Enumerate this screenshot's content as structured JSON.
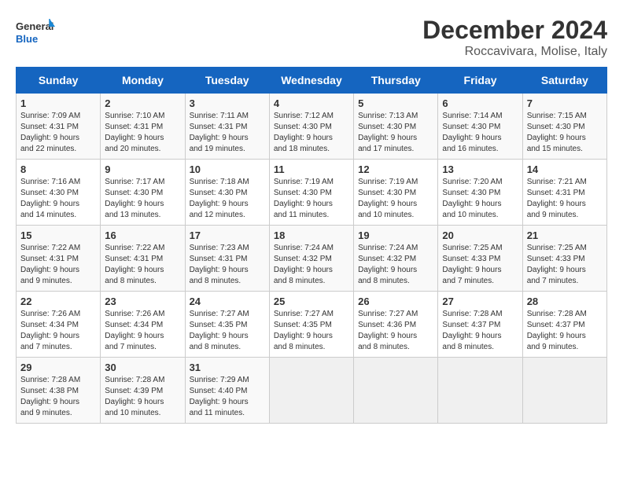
{
  "logo": {
    "line1": "General",
    "line2": "Blue"
  },
  "title": "December 2024",
  "subtitle": "Roccavivara, Molise, Italy",
  "days_of_week": [
    "Sunday",
    "Monday",
    "Tuesday",
    "Wednesday",
    "Thursday",
    "Friday",
    "Saturday"
  ],
  "weeks": [
    [
      {
        "day": "1",
        "info": "Sunrise: 7:09 AM\nSunset: 4:31 PM\nDaylight: 9 hours\nand 22 minutes."
      },
      {
        "day": "2",
        "info": "Sunrise: 7:10 AM\nSunset: 4:31 PM\nDaylight: 9 hours\nand 20 minutes."
      },
      {
        "day": "3",
        "info": "Sunrise: 7:11 AM\nSunset: 4:31 PM\nDaylight: 9 hours\nand 19 minutes."
      },
      {
        "day": "4",
        "info": "Sunrise: 7:12 AM\nSunset: 4:30 PM\nDaylight: 9 hours\nand 18 minutes."
      },
      {
        "day": "5",
        "info": "Sunrise: 7:13 AM\nSunset: 4:30 PM\nDaylight: 9 hours\nand 17 minutes."
      },
      {
        "day": "6",
        "info": "Sunrise: 7:14 AM\nSunset: 4:30 PM\nDaylight: 9 hours\nand 16 minutes."
      },
      {
        "day": "7",
        "info": "Sunrise: 7:15 AM\nSunset: 4:30 PM\nDaylight: 9 hours\nand 15 minutes."
      }
    ],
    [
      {
        "day": "8",
        "info": "Sunrise: 7:16 AM\nSunset: 4:30 PM\nDaylight: 9 hours\nand 14 minutes."
      },
      {
        "day": "9",
        "info": "Sunrise: 7:17 AM\nSunset: 4:30 PM\nDaylight: 9 hours\nand 13 minutes."
      },
      {
        "day": "10",
        "info": "Sunrise: 7:18 AM\nSunset: 4:30 PM\nDaylight: 9 hours\nand 12 minutes."
      },
      {
        "day": "11",
        "info": "Sunrise: 7:19 AM\nSunset: 4:30 PM\nDaylight: 9 hours\nand 11 minutes."
      },
      {
        "day": "12",
        "info": "Sunrise: 7:19 AM\nSunset: 4:30 PM\nDaylight: 9 hours\nand 10 minutes."
      },
      {
        "day": "13",
        "info": "Sunrise: 7:20 AM\nSunset: 4:30 PM\nDaylight: 9 hours\nand 10 minutes."
      },
      {
        "day": "14",
        "info": "Sunrise: 7:21 AM\nSunset: 4:31 PM\nDaylight: 9 hours\nand 9 minutes."
      }
    ],
    [
      {
        "day": "15",
        "info": "Sunrise: 7:22 AM\nSunset: 4:31 PM\nDaylight: 9 hours\nand 9 minutes."
      },
      {
        "day": "16",
        "info": "Sunrise: 7:22 AM\nSunset: 4:31 PM\nDaylight: 9 hours\nand 8 minutes."
      },
      {
        "day": "17",
        "info": "Sunrise: 7:23 AM\nSunset: 4:31 PM\nDaylight: 9 hours\nand 8 minutes."
      },
      {
        "day": "18",
        "info": "Sunrise: 7:24 AM\nSunset: 4:32 PM\nDaylight: 9 hours\nand 8 minutes."
      },
      {
        "day": "19",
        "info": "Sunrise: 7:24 AM\nSunset: 4:32 PM\nDaylight: 9 hours\nand 8 minutes."
      },
      {
        "day": "20",
        "info": "Sunrise: 7:25 AM\nSunset: 4:33 PM\nDaylight: 9 hours\nand 7 minutes."
      },
      {
        "day": "21",
        "info": "Sunrise: 7:25 AM\nSunset: 4:33 PM\nDaylight: 9 hours\nand 7 minutes."
      }
    ],
    [
      {
        "day": "22",
        "info": "Sunrise: 7:26 AM\nSunset: 4:34 PM\nDaylight: 9 hours\nand 7 minutes."
      },
      {
        "day": "23",
        "info": "Sunrise: 7:26 AM\nSunset: 4:34 PM\nDaylight: 9 hours\nand 7 minutes."
      },
      {
        "day": "24",
        "info": "Sunrise: 7:27 AM\nSunset: 4:35 PM\nDaylight: 9 hours\nand 8 minutes."
      },
      {
        "day": "25",
        "info": "Sunrise: 7:27 AM\nSunset: 4:35 PM\nDaylight: 9 hours\nand 8 minutes."
      },
      {
        "day": "26",
        "info": "Sunrise: 7:27 AM\nSunset: 4:36 PM\nDaylight: 9 hours\nand 8 minutes."
      },
      {
        "day": "27",
        "info": "Sunrise: 7:28 AM\nSunset: 4:37 PM\nDaylight: 9 hours\nand 8 minutes."
      },
      {
        "day": "28",
        "info": "Sunrise: 7:28 AM\nSunset: 4:37 PM\nDaylight: 9 hours\nand 9 minutes."
      }
    ],
    [
      {
        "day": "29",
        "info": "Sunrise: 7:28 AM\nSunset: 4:38 PM\nDaylight: 9 hours\nand 9 minutes."
      },
      {
        "day": "30",
        "info": "Sunrise: 7:28 AM\nSunset: 4:39 PM\nDaylight: 9 hours\nand 10 minutes."
      },
      {
        "day": "31",
        "info": "Sunrise: 7:29 AM\nSunset: 4:40 PM\nDaylight: 9 hours\nand 11 minutes."
      },
      {
        "day": "",
        "info": ""
      },
      {
        "day": "",
        "info": ""
      },
      {
        "day": "",
        "info": ""
      },
      {
        "day": "",
        "info": ""
      }
    ]
  ]
}
